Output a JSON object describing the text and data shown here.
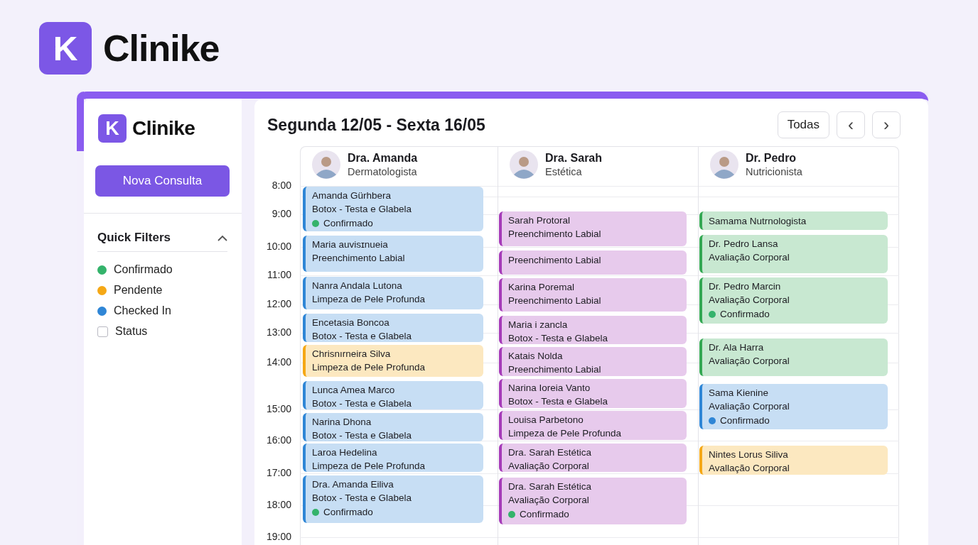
{
  "brand": {
    "logo_letter": "K",
    "name": "Clinike"
  },
  "sidebar": {
    "logo_letter": "K",
    "name": "Clinike",
    "new_button": "Nova Consulta",
    "filters_title": "Quick Filters",
    "filters_expanded": true,
    "filters": [
      {
        "kind": "dot",
        "label": "Confirmado",
        "color": "#34b36b"
      },
      {
        "kind": "dot",
        "label": "Pendente",
        "color": "#f5a816"
      },
      {
        "kind": "dot",
        "label": "Checked In",
        "color": "#2f86d6"
      },
      {
        "kind": "checkbox",
        "label": "Status",
        "checked": false
      }
    ]
  },
  "calendar": {
    "title": "Segunda 12/05 - Sexta 16/05",
    "filter_button": "Todas",
    "prev_button": "‹",
    "next_button": "›",
    "times": [
      "8:00",
      "9:00",
      "10:00",
      "11:00",
      "12:00",
      "13:00",
      "14:00",
      "15:00",
      "16:00",
      "17:00",
      "18:00",
      "19:00"
    ],
    "doctors": [
      {
        "name": "Dra. Amanda",
        "specialty": "Dermatologista",
        "events": [
          {
            "color": "#2f86d6",
            "lines": [
              "Amanda Gürhbera",
              "Botox - Testa e Glabela"
            ],
            "status": {
              "label": "Confirmado",
              "color": "#34b36b"
            }
          },
          {
            "color": "#2f86d6",
            "lines": [
              "Maria auvisɪnueia",
              "Preenchimento Labial"
            ]
          },
          {
            "color": "#2f86d6",
            "lines": [
              "Nanra Andala Lutona",
              "Limpeza de Pele Profunda"
            ]
          },
          {
            "color": "#2f86d6",
            "lines": [
              "Encetasia Boncoa",
              "Botox - Testa e Glabela"
            ]
          },
          {
            "color": "#f5a816",
            "lines": [
              "Chrisnırneira Silva",
              "Limpeza de Pele Profunda"
            ]
          },
          {
            "color": "#2f86d6",
            "lines": [
              "Lunca Amea Marco",
              "Botox - Testa e Glabela"
            ]
          },
          {
            "color": "#2f86d6",
            "lines": [
              "Narina Dhona",
              "Botox - Testa e Glabela"
            ]
          },
          {
            "color": "#2f86d6",
            "lines": [
              "Laroa Hedelina",
              "Limpeza de Pele Profunda"
            ]
          },
          {
            "color": "#2f86d6",
            "lines": [
              "Dra. Amanda Eiliva",
              "Botox - Testa e Glabela"
            ],
            "status": {
              "label": "Confirmado",
              "color": "#34b36b"
            }
          }
        ]
      },
      {
        "name": "Dra. Sarah",
        "specialty": "Estética",
        "events": [
          {
            "color": "#a53bb8",
            "lines": [
              "Sarah Protoral",
              "Preenchimento Labial"
            ]
          },
          {
            "color": "#a53bb8",
            "lines": [
              "Preenchimento Labial"
            ]
          },
          {
            "color": "#a53bb8",
            "lines": [
              "Karina Poremal",
              "Preenchimento Labial"
            ]
          },
          {
            "color": "#a53bb8",
            "lines": [
              "Maria i zancla",
              "Botox - Testa e Glabela"
            ]
          },
          {
            "color": "#a53bb8",
            "lines": [
              "Katais Nolda",
              "Preenchimento Labial"
            ]
          },
          {
            "color": "#a53bb8",
            "lines": [
              "Narina Ioreia Vanto",
              "Botox - Testa e Glabela"
            ]
          },
          {
            "color": "#a53bb8",
            "lines": [
              "Louisa Parbetono",
              "Limpeza de Pele Profunda"
            ]
          },
          {
            "color": "#a53bb8",
            "lines": [
              "Dra. Sarah Estética",
              "Avaliação Corporal"
            ]
          },
          {
            "color": "#a53bb8",
            "lines": [
              "Dra. Sarah Estética",
              "Avaliação Corporal"
            ],
            "status": {
              "label": "Confirmado",
              "color": "#34b36b"
            }
          }
        ]
      },
      {
        "name": "Dr. Pedro",
        "specialty": "Nutricionista",
        "events": [
          {
            "color": "#34a853",
            "lines": [
              "Samama Nutrnologista"
            ]
          },
          {
            "color": "#34a853",
            "lines": [
              "Dr. Pedro Lansa",
              "Avaliação Corporal"
            ]
          },
          {
            "color": "#34a853",
            "lines": [
              "Dr. Pedro Marcin",
              "Avaliação Corporal"
            ],
            "status": {
              "label": "Confirmado",
              "color": "#34b36b"
            }
          },
          {
            "color": "#34a853",
            "lines": [
              "Dr. Ala Harra",
              "Avaliação Corporal"
            ]
          },
          {
            "color": "#2f86d6",
            "lines": [
              "Sama Kienine",
              "Avaliação Corporal"
            ],
            "status": {
              "label": "Confirmado",
              "color": "#2f86d6"
            }
          },
          {
            "color": "#f5a816",
            "lines": [
              "Nintes Lorus Siliva",
              "Avallação Corporal"
            ]
          }
        ]
      }
    ]
  }
}
